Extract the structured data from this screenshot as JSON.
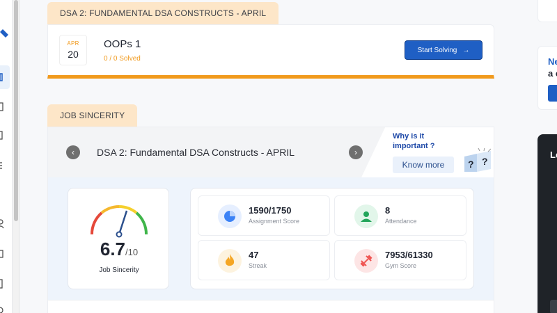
{
  "contest": {
    "tab_label": "DSA 2: FUNDAMENTAL DSA CONSTRUCTS - APRIL",
    "date_month": "APR",
    "date_day": "20",
    "title": "OOPs 1",
    "solved": "0 / 0 Solved",
    "start_button": "Start Solving",
    "progress_color": "#f19a1d"
  },
  "job_sincerity": {
    "tab_label": "JOB SINCERITY",
    "header_title": "DSA 2: Fundamental DSA Constructs - APRIL",
    "why_line1": "Why is it",
    "why_line2": "important ?",
    "know_more": "Know more",
    "gauge": {
      "score": "6.7",
      "out_of": "/10",
      "label": "Job Sincerity",
      "value_fraction": 0.67
    },
    "stats": [
      {
        "value": "1590/1750",
        "label": "Assignment Score",
        "icon": "pie-chart-icon",
        "color": "#3b82f6",
        "bg": "#e6efff"
      },
      {
        "value": "8",
        "label": "Attendance",
        "icon": "user-icon",
        "color": "#22a55a",
        "bg": "#e2f6ea"
      },
      {
        "value": "47",
        "label": "Streak",
        "icon": "flame-icon",
        "color": "#f5a623",
        "bg": "#fdf3df"
      },
      {
        "value": "7953/61330",
        "label": "Gym Score",
        "icon": "dumbbell-icon",
        "color": "#ef5350",
        "bg": "#fde5e5"
      }
    ]
  },
  "right_panel": {
    "card_text_1": "Ne",
    "card_text_2": "a c",
    "dark_card_text": "Le"
  },
  "colors": {
    "accent": "#1f5fc4",
    "orange": "#f19a1d",
    "tab_bg": "#fde6c8"
  }
}
